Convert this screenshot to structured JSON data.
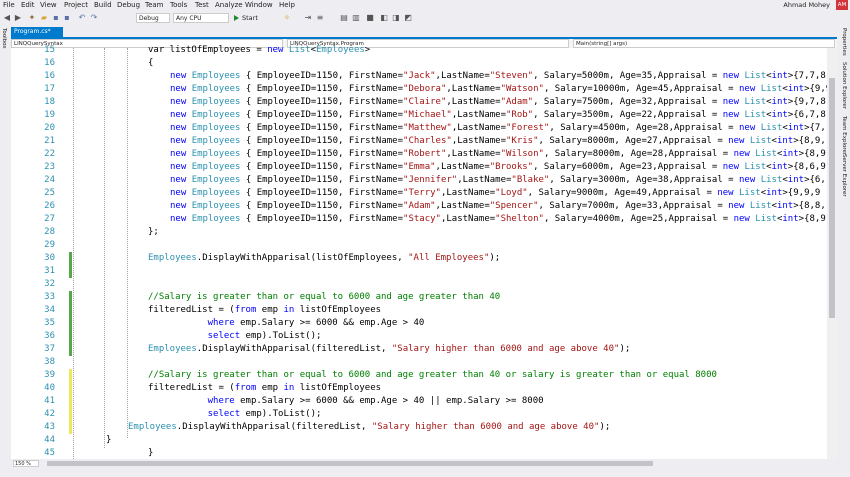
{
  "menu": [
    "File",
    "Edit",
    "View",
    "Project",
    "Build",
    "Debug",
    "Team",
    "Tools",
    "Test",
    "Analyze",
    "Window",
    "Help"
  ],
  "user": {
    "name": "Ahmad Mohey",
    "initials": "AM"
  },
  "toolbar": {
    "configuration": "Debug",
    "platform": "Any CPU",
    "start_label": "Start"
  },
  "left_panel": {
    "label": "Toolbox"
  },
  "right_panels": [
    "Properties",
    "Solution Explorer",
    "Team Explorer",
    "Server Explorer"
  ],
  "tab": {
    "label": "Program.cs*"
  },
  "nav": {
    "project": "LINQQuerySyntax",
    "class": "LINQQuerySyntax.Program",
    "member": "Main(string[] args)"
  },
  "zoom": "150 %",
  "lines": [
    {
      "n": "15",
      "bar": "none",
      "t": [
        [
          "",
          "var listOfEmployees = "
        ],
        [
          "kw",
          "new "
        ],
        [
          "ty",
          "List"
        ],
        [
          "",
          "<"
        ],
        [
          "ty",
          "Employees"
        ],
        [
          "",
          ">"
        ]
      ]
    },
    {
      "n": "16",
      "bar": "none",
      "t": [
        [
          "",
          "{"
        ]
      ]
    },
    {
      "n": "16",
      "bar": "none",
      "t": [
        [
          "kw",
          "new "
        ],
        [
          "ty",
          "Employees"
        ],
        [
          "",
          " { EmployeeID=1150, FirstName="
        ],
        [
          "st",
          "\"Jack\""
        ],
        [
          "",
          ",LastName="
        ],
        [
          "st",
          "\"Steven\""
        ],
        [
          "",
          ", Salary=5000m, Age=35,Appraisal = "
        ],
        [
          "kw",
          "new "
        ],
        [
          "ty",
          "List"
        ],
        [
          "",
          "<"
        ],
        [
          "kw",
          "int"
        ],
        [
          "",
          ">{7,7,8"
        ]
      ]
    },
    {
      "n": "17",
      "bar": "none",
      "t": [
        [
          "kw",
          "new "
        ],
        [
          "ty",
          "Employees"
        ],
        [
          "",
          " { EmployeeID=1150, FirstName="
        ],
        [
          "st",
          "\"Debora\""
        ],
        [
          "",
          ",LastName="
        ],
        [
          "st",
          "\"Watson\""
        ],
        [
          "",
          ", Salary=10000m, Age=45,Appraisal = "
        ],
        [
          "kw",
          "new "
        ],
        [
          "ty",
          "List"
        ],
        [
          "",
          "<"
        ],
        [
          "kw",
          "int"
        ],
        [
          "",
          ">{9,9"
        ]
      ]
    },
    {
      "n": "18",
      "bar": "none",
      "t": [
        [
          "kw",
          "new "
        ],
        [
          "ty",
          "Employees"
        ],
        [
          "",
          " { EmployeeID=1150, FirstName="
        ],
        [
          "st",
          "\"Claire\""
        ],
        [
          "",
          ",LastName="
        ],
        [
          "st",
          "\"Adam\""
        ],
        [
          "",
          ", Salary=7500m, Age=32,Appraisal = "
        ],
        [
          "kw",
          "new "
        ],
        [
          "ty",
          "List"
        ],
        [
          "",
          "<"
        ],
        [
          "kw",
          "int"
        ],
        [
          "",
          ">{9,7,8"
        ]
      ]
    },
    {
      "n": "19",
      "bar": "none",
      "t": [
        [
          "kw",
          "new "
        ],
        [
          "ty",
          "Employees"
        ],
        [
          "",
          " { EmployeeID=1150, FirstName="
        ],
        [
          "st",
          "\"Michael\""
        ],
        [
          "",
          ",LastName="
        ],
        [
          "st",
          "\"Rob\""
        ],
        [
          "",
          ", Salary=3500m, Age=22,Appraisal = "
        ],
        [
          "kw",
          "new "
        ],
        [
          "ty",
          "List"
        ],
        [
          "",
          "<"
        ],
        [
          "kw",
          "int"
        ],
        [
          "",
          ">{6,7,8"
        ]
      ]
    },
    {
      "n": "20",
      "bar": "none",
      "t": [
        [
          "kw",
          "new "
        ],
        [
          "ty",
          "Employees"
        ],
        [
          "",
          " { EmployeeID=1150, FirstName="
        ],
        [
          "st",
          "\"Matthew\""
        ],
        [
          "",
          ",LastName="
        ],
        [
          "st",
          "\"Forest\""
        ],
        [
          "",
          ", Salary=4500m, Age=28,Appraisal = "
        ],
        [
          "kw",
          "new "
        ],
        [
          "ty",
          "List"
        ],
        [
          "",
          "<"
        ],
        [
          "kw",
          "int"
        ],
        [
          "",
          ">{7,"
        ]
      ]
    },
    {
      "n": "21",
      "bar": "none",
      "t": [
        [
          "kw",
          "new "
        ],
        [
          "ty",
          "Employees"
        ],
        [
          "",
          " { EmployeeID=1150, FirstName="
        ],
        [
          "st",
          "\"Charles\""
        ],
        [
          "",
          ",LastName="
        ],
        [
          "st",
          "\"Kris\""
        ],
        [
          "",
          ", Salary=8000m, Age=27,Appraisal = "
        ],
        [
          "kw",
          "new "
        ],
        [
          "ty",
          "List"
        ],
        [
          "",
          "<"
        ],
        [
          "kw",
          "int"
        ],
        [
          "",
          ">{8,9,"
        ]
      ]
    },
    {
      "n": "22",
      "bar": "none",
      "t": [
        [
          "kw",
          "new "
        ],
        [
          "ty",
          "Employees"
        ],
        [
          "",
          " { EmployeeID=1150, FirstName="
        ],
        [
          "st",
          "\"Robert\""
        ],
        [
          "",
          ",LastName="
        ],
        [
          "st",
          "\"Wilson\""
        ],
        [
          "",
          ", Salary=8000m, Age=28,Appraisal = "
        ],
        [
          "kw",
          "new "
        ],
        [
          "ty",
          "List"
        ],
        [
          "",
          "<"
        ],
        [
          "kw",
          "int"
        ],
        [
          "",
          ">{8,9"
        ]
      ]
    },
    {
      "n": "23",
      "bar": "none",
      "t": [
        [
          "kw",
          "new "
        ],
        [
          "ty",
          "Employees"
        ],
        [
          "",
          " { EmployeeID=1150, FirstName="
        ],
        [
          "st",
          "\"Emma\""
        ],
        [
          "",
          ",LastName="
        ],
        [
          "st",
          "\"Brooks\""
        ],
        [
          "",
          ", Salary=6000m, Age=23,Appraisal = "
        ],
        [
          "kw",
          "new "
        ],
        [
          "ty",
          "List"
        ],
        [
          "",
          "<"
        ],
        [
          "kw",
          "int"
        ],
        [
          "",
          ">{8,6,9"
        ]
      ]
    },
    {
      "n": "24",
      "bar": "none",
      "t": [
        [
          "kw",
          "new "
        ],
        [
          "ty",
          "Employees"
        ],
        [
          "",
          " { EmployeeID=1150, FirstName="
        ],
        [
          "st",
          "\"Jennifer\""
        ],
        [
          "",
          ",LastName="
        ],
        [
          "st",
          "\"Blake\""
        ],
        [
          "",
          ", Salary=3000m, Age=38,Appraisal = "
        ],
        [
          "kw",
          "new "
        ],
        [
          "ty",
          "List"
        ],
        [
          "",
          "<"
        ],
        [
          "kw",
          "int"
        ],
        [
          "",
          ">{6,"
        ]
      ]
    },
    {
      "n": "25",
      "bar": "none",
      "t": [
        [
          "kw",
          "new "
        ],
        [
          "ty",
          "Employees"
        ],
        [
          "",
          " { EmployeeID=1150, FirstName="
        ],
        [
          "st",
          "\"Terry\""
        ],
        [
          "",
          ",LastName="
        ],
        [
          "st",
          "\"Loyd\""
        ],
        [
          "",
          ", Salary=9000m, Age=49,Appraisal = "
        ],
        [
          "kw",
          "new "
        ],
        [
          "ty",
          "List"
        ],
        [
          "",
          "<"
        ],
        [
          "kw",
          "int"
        ],
        [
          "",
          ">{9,9,9"
        ]
      ]
    },
    {
      "n": "26",
      "bar": "none",
      "t": [
        [
          "kw",
          "new "
        ],
        [
          "ty",
          "Employees"
        ],
        [
          "",
          " { EmployeeID=1150, FirstName="
        ],
        [
          "st",
          "\"Adam\""
        ],
        [
          "",
          ",LastName="
        ],
        [
          "st",
          "\"Spencer\""
        ],
        [
          "",
          ", Salary=7000m, Age=33,Appraisal = "
        ],
        [
          "kw",
          "new "
        ],
        [
          "ty",
          "List"
        ],
        [
          "",
          "<"
        ],
        [
          "kw",
          "int"
        ],
        [
          "",
          ">{8,8,"
        ]
      ]
    },
    {
      "n": "27",
      "bar": "none",
      "t": [
        [
          "kw",
          "new "
        ],
        [
          "ty",
          "Employees"
        ],
        [
          "",
          " { EmployeeID=1150, FirstName="
        ],
        [
          "st",
          "\"Stacy\""
        ],
        [
          "",
          ",LastName="
        ],
        [
          "st",
          "\"Shelton\""
        ],
        [
          "",
          ", Salary=4000m, Age=25,Appraisal = "
        ],
        [
          "kw",
          "new "
        ],
        [
          "ty",
          "List"
        ],
        [
          "",
          "<"
        ],
        [
          "kw",
          "int"
        ],
        [
          "",
          ">{8,9,"
        ]
      ]
    },
    {
      "n": "28",
      "bar": "none",
      "t": [
        [
          "",
          "};"
        ]
      ]
    },
    {
      "n": "29",
      "bar": "none",
      "t": []
    },
    {
      "n": "30",
      "bar": "green",
      "t": [
        [
          "ty",
          "Employees"
        ],
        [
          "",
          ".DisplayWithApparisal(listOfEmployees, "
        ],
        [
          "st",
          "\"All Employees\""
        ],
        [
          "",
          ");"
        ]
      ]
    },
    {
      "n": "31",
      "bar": "green",
      "t": []
    },
    {
      "n": "32",
      "bar": "none",
      "t": []
    },
    {
      "n": "33",
      "bar": "green",
      "t": [
        [
          "cm",
          "//Salary is greater than or equal to 6000 and age greater than 40"
        ]
      ]
    },
    {
      "n": "34",
      "bar": "green",
      "t": [
        [
          "",
          "filteredList = ("
        ],
        [
          "kw",
          "from "
        ],
        [
          "",
          "emp "
        ],
        [
          "kw",
          "in "
        ],
        [
          "",
          "listOfEmployees"
        ]
      ]
    },
    {
      "n": "35",
      "bar": "green",
      "t": [
        [
          "",
          "           "
        ],
        [
          "kw",
          "where "
        ],
        [
          "",
          "emp.Salary >= 6000 && emp.Age > 40"
        ]
      ]
    },
    {
      "n": "36",
      "bar": "green",
      "t": [
        [
          "",
          "           "
        ],
        [
          "kw",
          "select "
        ],
        [
          "",
          "emp).ToList();"
        ]
      ]
    },
    {
      "n": "37",
      "bar": "green",
      "t": [
        [
          "ty",
          "Employees"
        ],
        [
          "",
          ".DisplayWithApparisal(filteredList, "
        ],
        [
          "st",
          "\"Salary higher than 6000 and age above 40\""
        ],
        [
          "",
          ");"
        ]
      ]
    },
    {
      "n": "38",
      "bar": "none",
      "t": []
    },
    {
      "n": "39",
      "bar": "yellow",
      "t": [
        [
          "cm",
          "//Salary is greater than or equal to 6000 and age greater than 40 or salary is greater than or equal 8000"
        ]
      ]
    },
    {
      "n": "40",
      "bar": "yellow",
      "t": [
        [
          "",
          "filteredList = ("
        ],
        [
          "kw",
          "from "
        ],
        [
          "",
          "emp "
        ],
        [
          "kw",
          "in "
        ],
        [
          "",
          "listOfEmployees"
        ]
      ]
    },
    {
      "n": "41",
      "bar": "yellow",
      "t": [
        [
          "",
          "           "
        ],
        [
          "kw",
          "where "
        ],
        [
          "",
          "emp.Salary >= 6000 && emp.Age > 40 || emp.Salary >= 8000"
        ]
      ]
    },
    {
      "n": "42",
      "bar": "yellow",
      "t": [
        [
          "",
          "           "
        ],
        [
          "kw",
          "select "
        ],
        [
          "",
          "emp).ToList();"
        ]
      ]
    },
    {
      "n": "43",
      "bar": "yellow",
      "t": [
        [
          "ty",
          "Employees"
        ],
        [
          "",
          ".DisplayWithApparisal(filteredList, "
        ],
        [
          "st",
          "\"Salary higher than 6000 and age above 40\""
        ],
        [
          "",
          ");"
        ]
      ]
    },
    {
      "n": "44",
      "bar": "none",
      "t": [
        [
          "",
          "}"
        ]
      ]
    },
    {
      "n": "45",
      "bar": "none",
      "t": [
        [
          "",
          "}"
        ]
      ]
    }
  ]
}
